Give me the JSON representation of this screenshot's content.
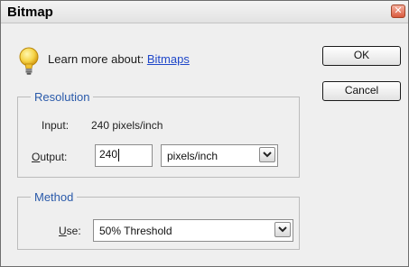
{
  "dialog": {
    "title": "Bitmap",
    "close_glyph": "✕"
  },
  "help": {
    "prefix": "Learn more about:",
    "link": "Bitmaps"
  },
  "buttons": {
    "ok": "OK",
    "cancel": "Cancel"
  },
  "resolution": {
    "legend": "Resolution",
    "input_label": "Input:",
    "input_value": "240 pixels/inch",
    "output_label_first": "O",
    "output_label_rest": "utput:",
    "output_value": "240",
    "output_unit": "pixels/inch"
  },
  "method": {
    "legend": "Method",
    "use_label_first": "U",
    "use_label_rest": "se:",
    "use_value": "50% Threshold"
  },
  "icons": {
    "help": "lightbulb-icon",
    "dropdown": "chevron-down-icon",
    "close": "close-icon"
  },
  "colors": {
    "legend": "#2a5aaa",
    "link": "#1f47c9",
    "close": "#d9583c"
  }
}
